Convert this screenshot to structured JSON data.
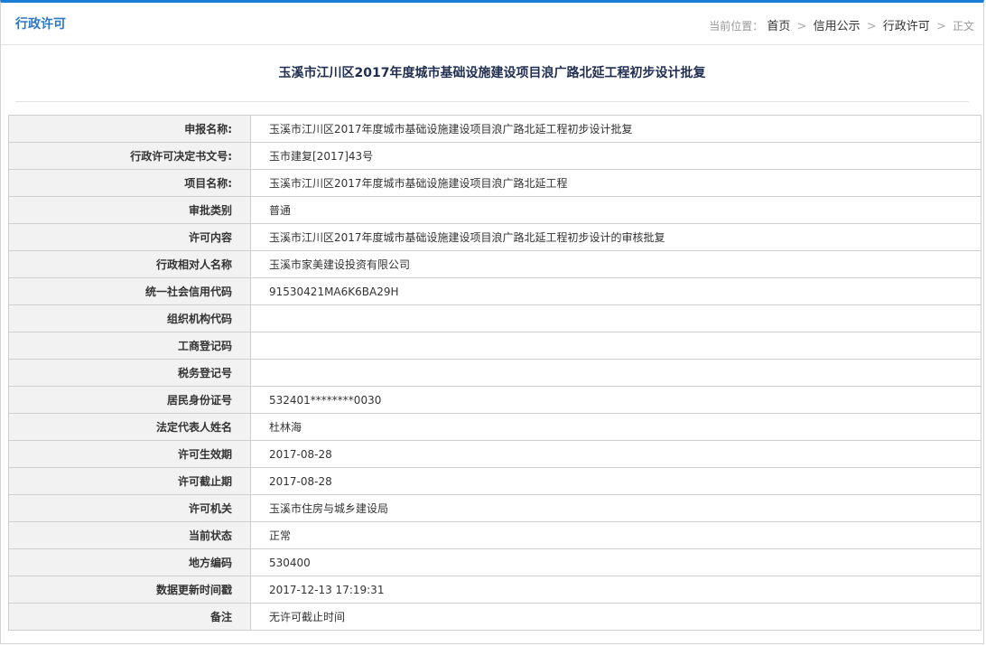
{
  "header": {
    "section_title": "行政许可",
    "breadcrumb": {
      "prefix": "当前位置：",
      "items": [
        "首页",
        "信用公示",
        "行政许可"
      ],
      "separator": ">",
      "current": "正文"
    }
  },
  "page_title": "玉溪市江川区2017年度城市基础设施建设项目浪广路北延工程初步设计批复",
  "details": [
    {
      "label": "申报名称:",
      "value": "玉溪市江川区2017年度城市基础设施建设项目浪广路北延工程初步设计批复"
    },
    {
      "label": "行政许可决定书文号:",
      "value": "玉市建复[2017]43号"
    },
    {
      "label": "项目名称:",
      "value": "玉溪市江川区2017年度城市基础设施建设项目浪广路北延工程"
    },
    {
      "label": "审批类别",
      "value": "普通"
    },
    {
      "label": "许可内容",
      "value": "玉溪市江川区2017年度城市基础设施建设项目浪广路北延工程初步设计的审核批复"
    },
    {
      "label": "行政相对人名称",
      "value": "玉溪市家美建设投资有限公司"
    },
    {
      "label": "统一社会信用代码",
      "value": "91530421MA6K6BA29H"
    },
    {
      "label": "组织机构代码",
      "value": ""
    },
    {
      "label": "工商登记码",
      "value": ""
    },
    {
      "label": "税务登记号",
      "value": ""
    },
    {
      "label": "居民身份证号",
      "value": "532401********0030"
    },
    {
      "label": "法定代表人姓名",
      "value": "杜林海"
    },
    {
      "label": "许可生效期",
      "value": "2017-08-28"
    },
    {
      "label": "许可截止期",
      "value": "2017-08-28"
    },
    {
      "label": "许可机关",
      "value": "玉溪市住房与城乡建设局"
    },
    {
      "label": "当前状态",
      "value": "正常"
    },
    {
      "label": "地方编码",
      "value": "530400"
    },
    {
      "label": "数据更新时间戳",
      "value": "2017-12-13 17:19:31"
    },
    {
      "label": "备注",
      "value": "无许可截止时间"
    }
  ],
  "colors": {
    "accent": "#1a7fd4",
    "section_title": "#2b78c5",
    "heading": "#1f2d4f",
    "label_bg": "#f2f2f2",
    "border": "#cfcfcf"
  }
}
